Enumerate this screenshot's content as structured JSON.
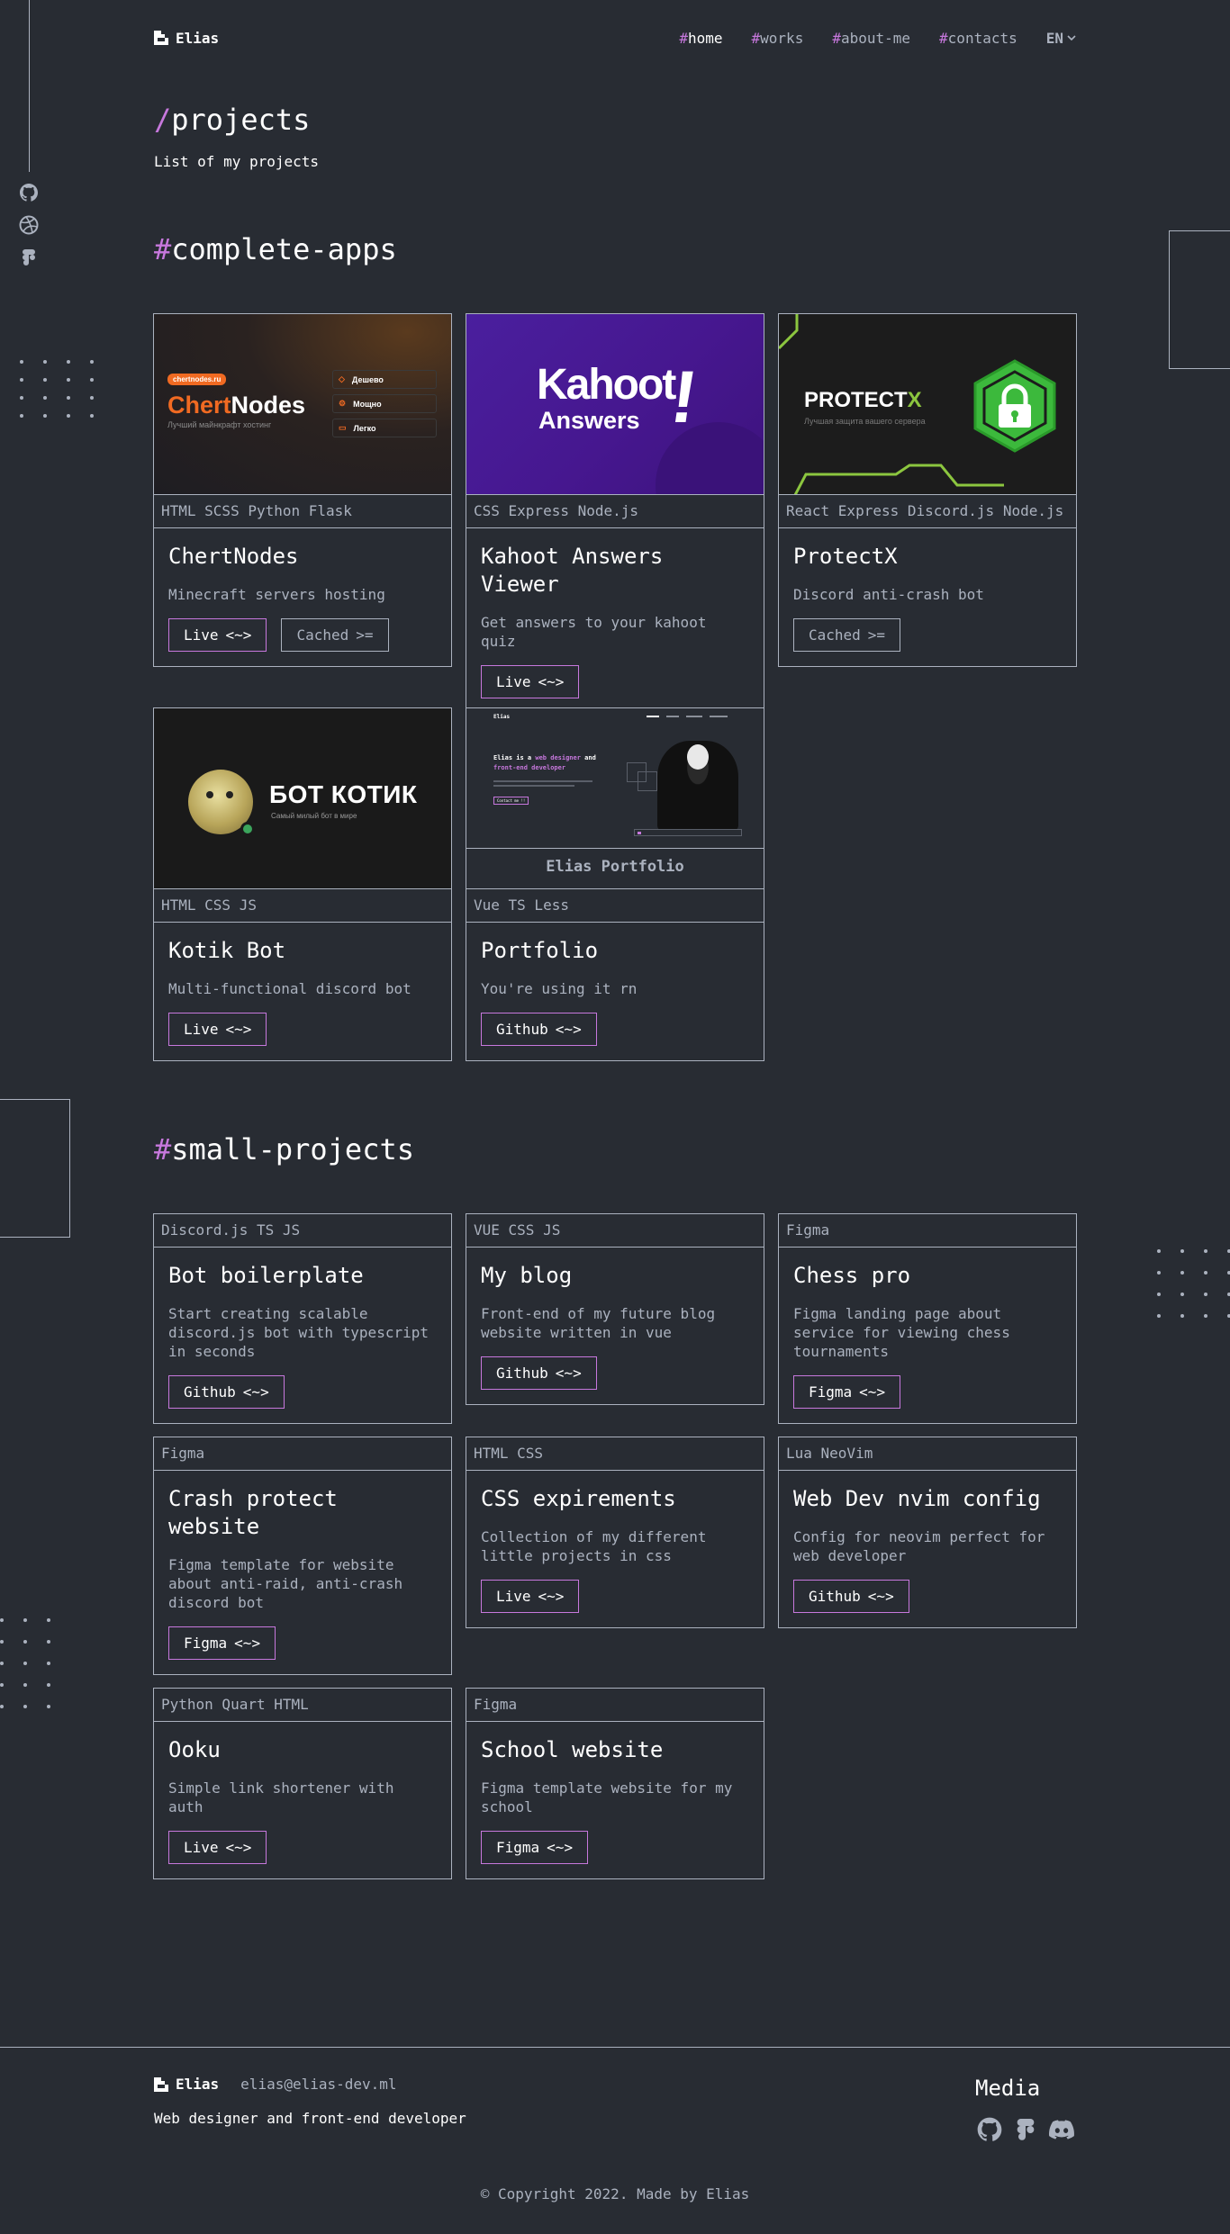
{
  "header": {
    "logo": "Elias",
    "nav": [
      {
        "hash": "#",
        "label": "home"
      },
      {
        "hash": "#",
        "label": "works"
      },
      {
        "hash": "#",
        "label": "about-me"
      },
      {
        "hash": "#",
        "label": "contacts"
      }
    ],
    "lang": "EN"
  },
  "page": {
    "slash": "/",
    "title": "projects",
    "subtitle": "List of my projects"
  },
  "sections": {
    "complete": {
      "hash": "#",
      "title": "complete-apps"
    },
    "small": {
      "hash": "#",
      "title": "small-projects"
    }
  },
  "complete_apps": [
    {
      "tech": "HTML SCSS Python Flask",
      "name": "ChertNodes",
      "desc": "Minecraft servers hosting",
      "btn1": "Live",
      "btn2": "Cached",
      "thumb": {
        "badge": "chertnodes.ru",
        "title_a": "Chert",
        "title_b": "Nodes",
        "tagline": "Лучший майнкрафт хостинг",
        "features": [
          "Дешево",
          "Мощно",
          "Легко"
        ]
      }
    },
    {
      "tech": "CSS Express Node.js",
      "name": "Kahoot Answers Viewer",
      "desc": "Get answers to your kahoot quiz",
      "btn1": "Live",
      "thumb": {
        "line1": "Kahoot",
        "line2": "Answers",
        "mark": "!"
      }
    },
    {
      "tech": "React Express Discord.js Node.js",
      "name": "ProtectX",
      "desc": "Discord anti-crash bot",
      "btn2": "Cached",
      "thumb": {
        "title_a": "PROTECT",
        "title_b": "X",
        "tagline": "Лучшая защита вашего сервера"
      }
    },
    {
      "tech": "HTML CSS JS",
      "name": "Kotik Bot",
      "desc": "Multi-functional discord bot",
      "btn1": "Live",
      "thumb": {
        "title": "БОТ КОТИК",
        "tagline": "Самый милый бот в мире"
      }
    },
    {
      "tech": "Vue TS Less",
      "name": "Portfolio",
      "desc": "You're using it rn",
      "btn1": "Github",
      "thumb": {
        "caption": "Elias Portfolio",
        "mini_logo": "Elias",
        "mini_line1": "Elias is a",
        "mini_accent1": "web designer",
        "mini_line1b": "and",
        "mini_accent2": "front-end developer",
        "mini_btn": "Contact me !!"
      }
    }
  ],
  "small_projects": [
    {
      "tech": "Discord.js TS JS",
      "name": "Bot boilerplate",
      "desc": "Start creating scalable discord.js bot with typescript in seconds",
      "btn": "Github"
    },
    {
      "tech": "VUE CSS JS",
      "name": "My blog",
      "desc": "Front-end of my future blog website written in vue",
      "btn": "Github"
    },
    {
      "tech": "Figma",
      "name": "Chess pro",
      "desc": "Figma landing page about service for viewing chess tournaments",
      "btn": "Figma"
    },
    {
      "tech": "Figma",
      "name": "Crash protect website",
      "desc": "Figma template for website about anti-raid, anti-crash discord bot",
      "btn": "Figma"
    },
    {
      "tech": "HTML CSS",
      "name": "CSS expirements",
      "desc": "Collection of my different little projects in css",
      "btn": "Live"
    },
    {
      "tech": "Lua NeoVim",
      "name": "Web Dev nvim config",
      "desc": "Config for neovim perfect for web developer",
      "btn": "Github"
    },
    {
      "tech": "Python Quart HTML",
      "name": "Ooku",
      "desc": "Simple link shortener with auth",
      "btn": "Live"
    },
    {
      "tech": "Figma",
      "name": "School website",
      "desc": "Figma template website for my school",
      "btn": "Figma"
    }
  ],
  "button_glyphs": {
    "live": "<~>",
    "cached": ">="
  },
  "footer": {
    "logo": "Elias",
    "email": "elias@elias-dev.ml",
    "role": "Web designer and front-end developer",
    "media_title": "Media",
    "copyright": "© Copyright 2022. Made by Elias"
  },
  "colors": {
    "background": "#282C33",
    "accent": "#C778DD",
    "text": "#ABB2BF",
    "white": "#FFFFFF"
  },
  "icons": [
    "github-icon",
    "dribbble-icon",
    "figma-icon",
    "discord-icon",
    "logo-icon",
    "chevron-down-icon"
  ]
}
